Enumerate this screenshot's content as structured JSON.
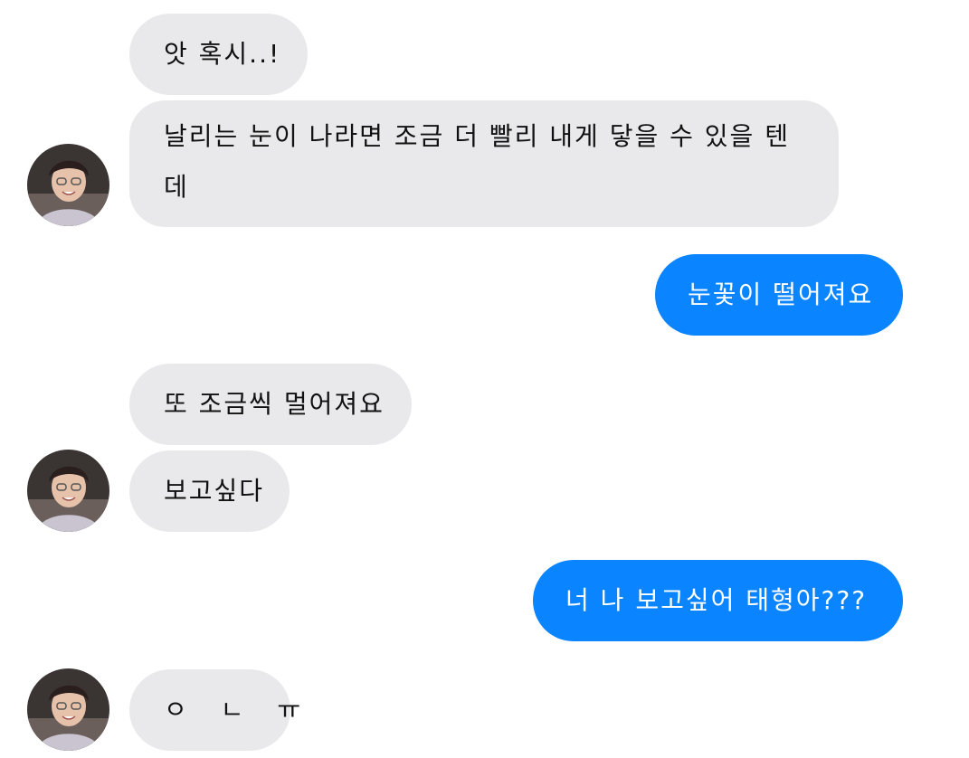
{
  "messages": [
    {
      "direction": "incoming",
      "text": "앗 혹시..!"
    },
    {
      "direction": "incoming",
      "text": "날리는 눈이 나라면 조금 더 빨리 내게 닿을 수 있을 텐데"
    },
    {
      "direction": "outgoing",
      "text": "눈꽃이 떨어져요"
    },
    {
      "direction": "incoming",
      "text": "또 조금씩 멀어져요"
    },
    {
      "direction": "incoming",
      "text": "보고싶다"
    },
    {
      "direction": "outgoing",
      "text": "너 나 보고싶어 태형아???"
    },
    {
      "direction": "incoming",
      "text": "ㅇ ㄴ ㅠ"
    }
  ],
  "colors": {
    "incoming_bubble": "#e9e9eb",
    "outgoing_bubble": "#0a84ff",
    "incoming_text": "#111111",
    "outgoing_text": "#ffffff"
  },
  "avatar": {
    "icon": "contact-avatar"
  }
}
